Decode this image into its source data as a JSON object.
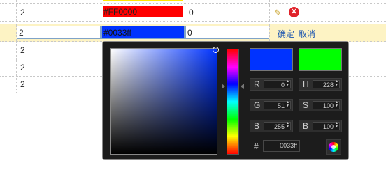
{
  "grid": {
    "top_row": {
      "count": "2",
      "color_text": "#FF0000",
      "color_hex": "#FF0000",
      "value": "0"
    },
    "edit_row": {
      "count": "2",
      "color_input_value": "#0033ff",
      "value_input": "0",
      "confirm_label": "确定",
      "cancel_label": "取消"
    },
    "rows": [
      {
        "count": "2"
      },
      {
        "count": "2"
      },
      {
        "count": "2"
      }
    ],
    "cut_row": {
      "swatch_color": "#FFE800"
    }
  },
  "picker": {
    "new_color": "#0033ff",
    "current_color": "#00ff00",
    "fields": {
      "r": {
        "label": "R",
        "value": "0"
      },
      "g": {
        "label": "G",
        "value": "51"
      },
      "b": {
        "label": "B",
        "value": "255"
      },
      "h": {
        "label": "H",
        "value": "228"
      },
      "s": {
        "label": "S",
        "value": "100"
      },
      "v": {
        "label": "B",
        "value": "100"
      }
    },
    "hex_label": "#",
    "hex_value": "0033ff",
    "icons": {
      "edit": "pencil-icon",
      "delete": "delete-icon",
      "wheel": "color-wheel-icon"
    }
  }
}
